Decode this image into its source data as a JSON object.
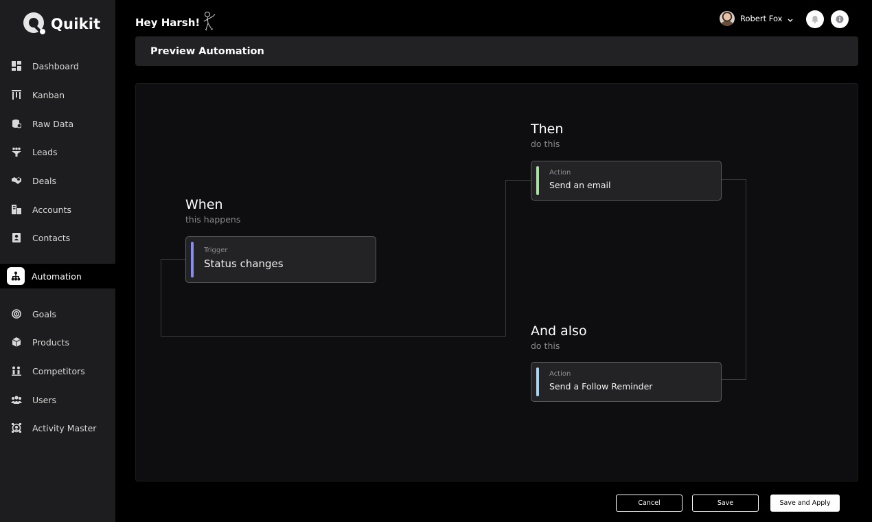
{
  "app": {
    "name": "Quikit"
  },
  "header": {
    "greeting": "Hey Harsh!",
    "user_name": "Robert Fox"
  },
  "sidebar": {
    "items": [
      {
        "label": "Dashboard",
        "icon": "dashboard-icon"
      },
      {
        "label": "Kanban",
        "icon": "kanban-icon"
      },
      {
        "label": "Raw Data",
        "icon": "raw-data-icon"
      },
      {
        "label": "Leads",
        "icon": "leads-icon"
      },
      {
        "label": "Deals",
        "icon": "deals-icon"
      },
      {
        "label": "Accounts",
        "icon": "accounts-icon"
      },
      {
        "label": "Contacts",
        "icon": "contacts-icon"
      },
      {
        "label": "Automation",
        "icon": "automation-icon",
        "active": true
      },
      {
        "label": "Goals",
        "icon": "goals-icon"
      },
      {
        "label": "Products",
        "icon": "products-icon"
      },
      {
        "label": "Competitors",
        "icon": "competitors-icon"
      },
      {
        "label": "Users",
        "icon": "users-icon"
      },
      {
        "label": "Activity Master",
        "icon": "activity-master-icon"
      }
    ]
  },
  "page": {
    "title": "Preview Automation"
  },
  "flow": {
    "when": {
      "title": "When",
      "subtitle": "this happens",
      "card_label": "Trigger",
      "card_value": "Status changes",
      "accent": "#8b8cf0"
    },
    "then": {
      "title": "Then",
      "subtitle": "do this",
      "card_label": "Action",
      "card_value": "Send an email",
      "accent": "#a6e3a1"
    },
    "and_also": {
      "title": "And also",
      "subtitle": "do this",
      "card_label": "Action",
      "card_value": "Send a Follow Reminder",
      "accent": "#a7d3f5"
    }
  },
  "footer": {
    "cancel_label": "Cancel",
    "save_label": "Save",
    "save_apply_label": "Save and Apply"
  },
  "colors": {
    "background": "#000000",
    "sidebar": "#1d1d1f",
    "panel": "#222225",
    "canvas": "#0e0e10",
    "card": "#232326"
  }
}
